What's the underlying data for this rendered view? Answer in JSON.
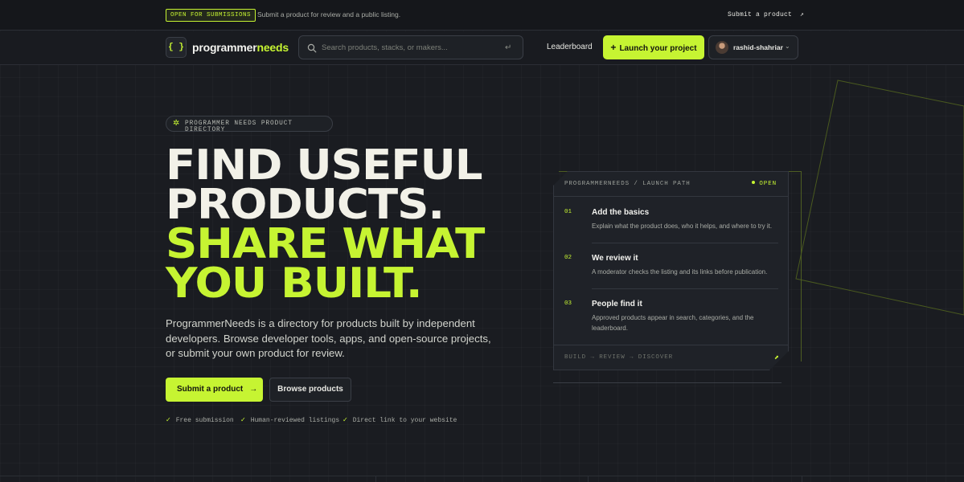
{
  "announcement": {
    "badge": "OPEN FOR SUBMISSIONS",
    "text": "Submit a product for review and a public listing.",
    "link": "Submit a product",
    "link_icon": "arrow-up-right-icon"
  },
  "nav": {
    "logo_glyph": "{ }",
    "logo_part1": "programmer",
    "logo_part2": "needs",
    "search_placeholder": "Search products, stacks, or makers...",
    "search_value": "",
    "enter_glyph": "↵",
    "leaderboard": "Leaderboard",
    "launch_label": "Launch your project",
    "username": "rashid-shahriar"
  },
  "hero": {
    "eyebrow": "PROGRAMMER NEEDS PRODUCT DIRECTORY",
    "headline_1": "FIND USEFUL",
    "headline_2": "PRODUCTS.",
    "headline_3": "SHARE WHAT",
    "headline_4": "YOU BUILT.",
    "intro": "ProgrammerNeeds is a directory for products built by independent developers. Browse developer tools, apps, and open-source projects, or submit your own product for review.",
    "submit_label": "Submit a product",
    "browse_label": "Browse products",
    "checks": [
      "Free submission",
      "Human-reviewed listings",
      "Direct link to your website"
    ]
  },
  "card": {
    "header": "PROGRAMMERNEEDS / LAUNCH PATH",
    "status": "OPEN",
    "steps": [
      {
        "num": "01",
        "title": "Add the basics",
        "desc": "Explain what the product does, who it helps, and where to try it."
      },
      {
        "num": "02",
        "title": "We review it",
        "desc": "A moderator checks the listing and its links before publication."
      },
      {
        "num": "03",
        "title": "People find it",
        "desc": "Approved products appear in search, categories, and the leaderboard."
      }
    ],
    "footer": "BUILD → REVIEW → DISCOVER"
  },
  "colors": {
    "accent": "#c6f432",
    "background": "#1a1c21",
    "text": "#f2f1e8"
  }
}
